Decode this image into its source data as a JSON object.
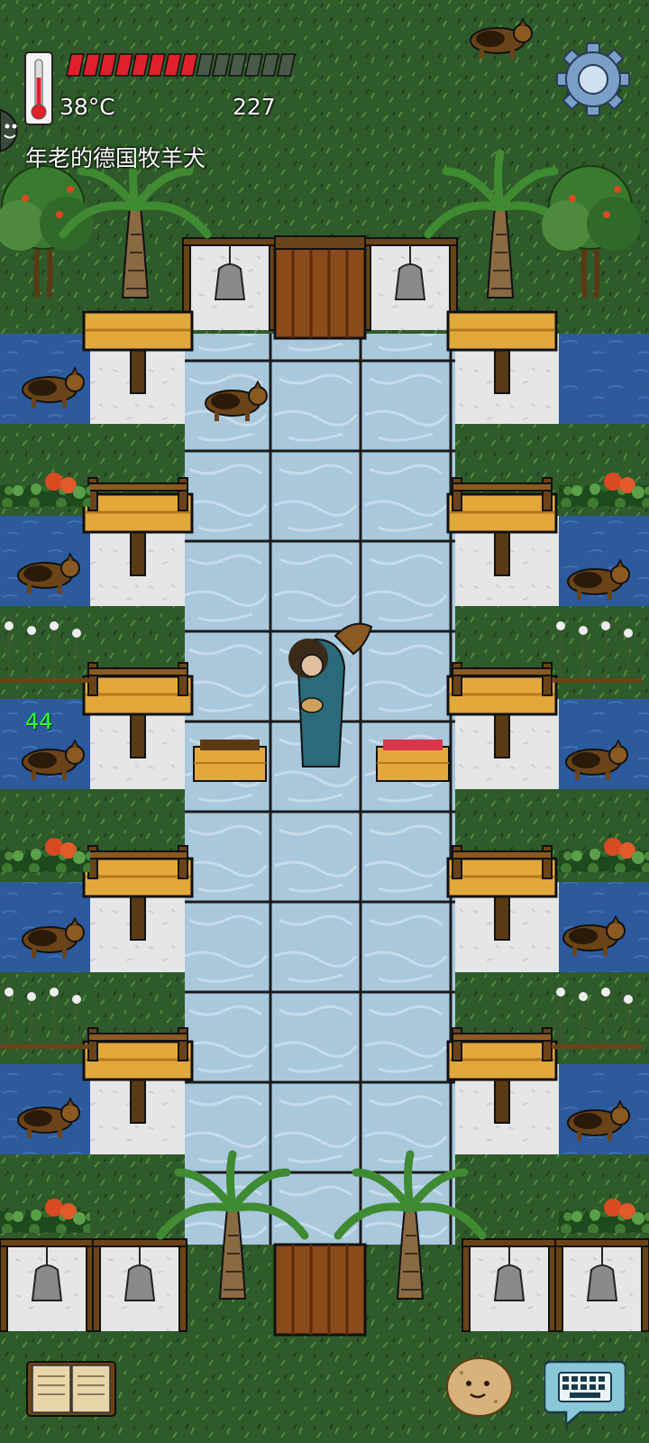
{
  "hud": {
    "temperature": "38°C",
    "food_value": "227",
    "hunger_fill": 0.56,
    "hunger_pips_total": 14,
    "player_name": "年老的德国牧羊犬",
    "floating_stat": "44"
  },
  "icons": {
    "thermometer": "thermometer-icon",
    "settings": "gear-icon",
    "tech_book": "book-icon",
    "emote": "potato-face-icon",
    "chat": "keyboard-icon"
  },
  "colors": {
    "grass": "#2f5a2a",
    "ice_floor": "#a9c8dc",
    "water": "#2c5a9c",
    "snow": "#e6e6e6",
    "wood": "#e0a93a",
    "hunger_red": "#e0202a",
    "stat_green": "#2fff3a"
  }
}
